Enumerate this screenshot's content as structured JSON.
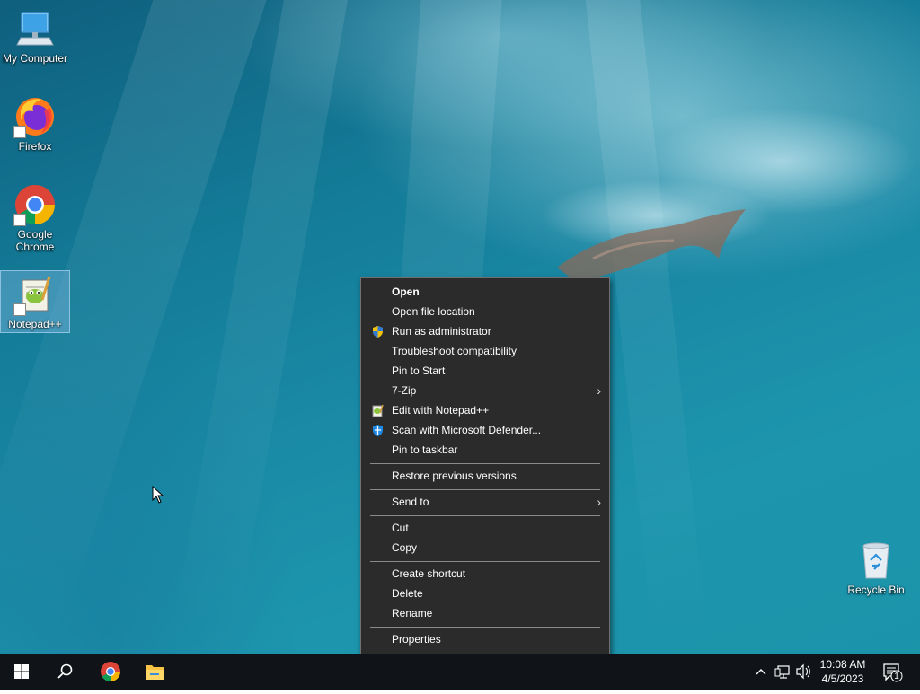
{
  "desktop_icons": [
    {
      "label": "My Computer"
    },
    {
      "label": "Firefox"
    },
    {
      "label": "Google Chrome"
    },
    {
      "label": "Notepad++"
    },
    {
      "label": "Recycle Bin"
    }
  ],
  "context_menu": {
    "items": [
      {
        "label": "Open",
        "bold": true
      },
      {
        "label": "Open file location"
      },
      {
        "label": "Run as administrator",
        "icon": "uac-shield-icon"
      },
      {
        "label": "Troubleshoot compatibility"
      },
      {
        "label": "Pin to Start"
      },
      {
        "label": "7-Zip",
        "submenu": true
      },
      {
        "label": "Edit with Notepad++",
        "icon": "notepadpp-icon"
      },
      {
        "label": "Scan with Microsoft Defender...",
        "icon": "defender-icon"
      },
      {
        "label": "Pin to taskbar"
      },
      {
        "label": "Restore previous versions"
      },
      {
        "label": "Send to",
        "submenu": true
      },
      {
        "label": "Cut"
      },
      {
        "label": "Copy"
      },
      {
        "label": "Create shortcut"
      },
      {
        "label": "Delete"
      },
      {
        "label": "Rename"
      },
      {
        "label": "Properties"
      }
    ],
    "submenu_arrow": "›"
  },
  "taskbar": {
    "pinned": [
      "windows-start-icon",
      "search-icon",
      "chrome-icon",
      "file-explorer-icon"
    ],
    "tray_icons": [
      "chevron-up-icon",
      "network-icon",
      "volume-icon"
    ],
    "time": "10:08 AM",
    "date": "4/5/2023",
    "notification_count": "1"
  },
  "colors": {
    "menu_bg": "#2b2b2b",
    "taskbar_bg": "#101418",
    "accent": "#0078d7"
  }
}
